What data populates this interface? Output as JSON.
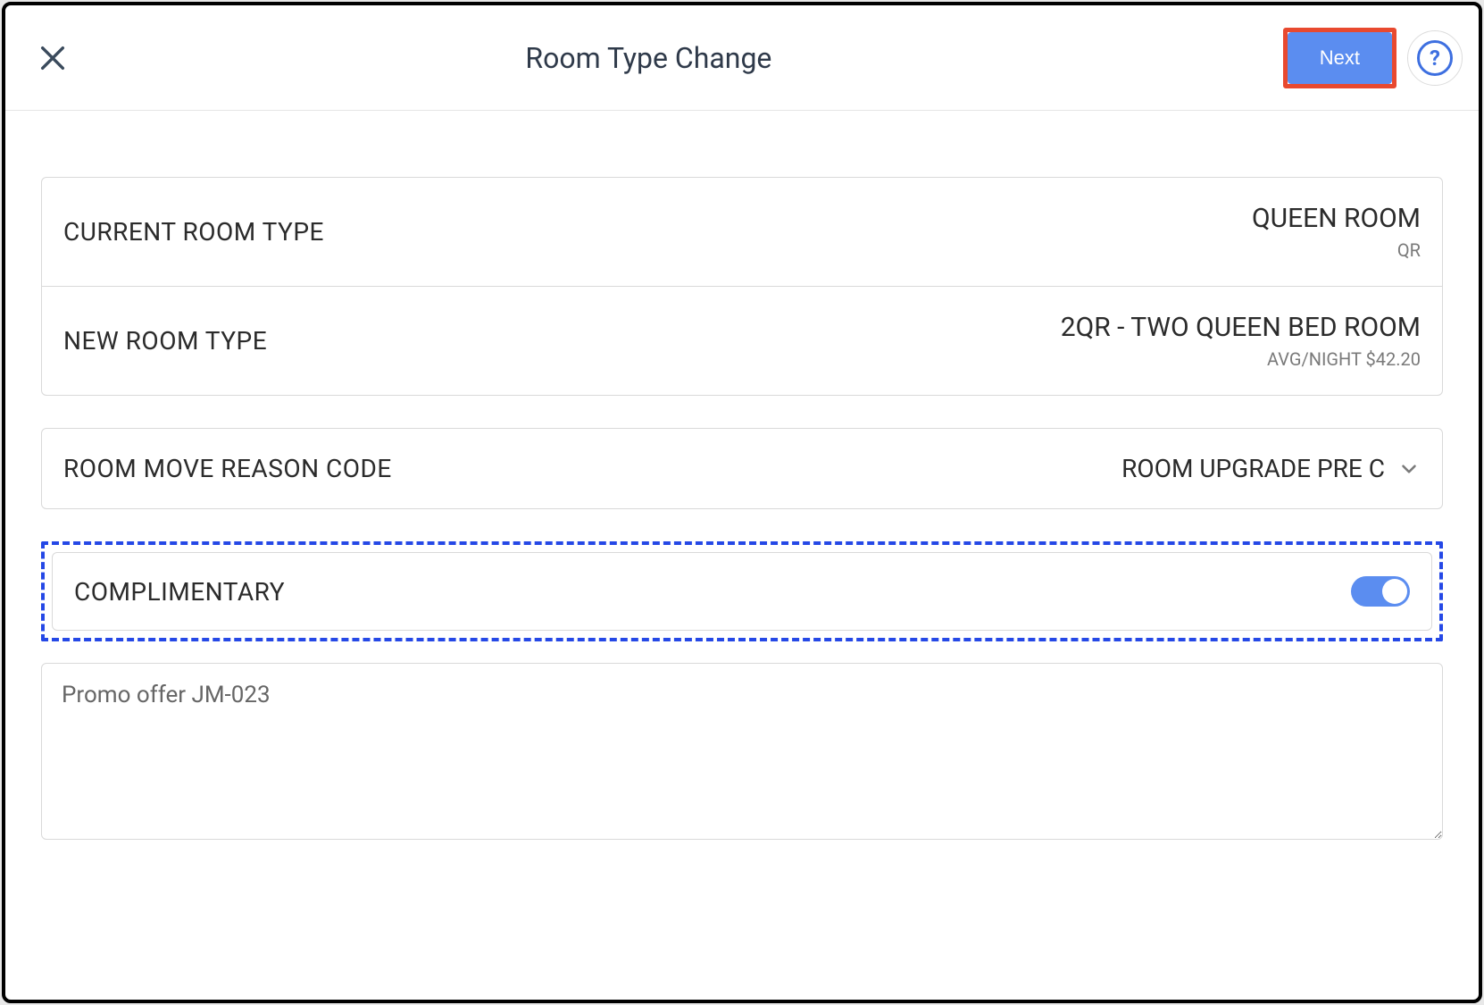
{
  "header": {
    "title": "Room Type Change",
    "next_label": "Next",
    "help_symbol": "?"
  },
  "current": {
    "label": "CURRENT ROOM TYPE",
    "value": "QUEEN ROOM",
    "code": "QR"
  },
  "new": {
    "label": "NEW ROOM TYPE",
    "value": "2QR - TWO QUEEN BED ROOM",
    "sub": "AVG/NIGHT $42.20"
  },
  "reason": {
    "label": "ROOM MOVE REASON CODE",
    "selected": "ROOM UPGRADE PRE C"
  },
  "complimentary": {
    "label": "COMPLIMENTARY",
    "on": true
  },
  "notes": {
    "value": "Promo offer JM-023"
  },
  "colors": {
    "accent_blue": "#5b8df0",
    "callout_red": "#e8492f",
    "dashed_blue": "#2548e6"
  }
}
